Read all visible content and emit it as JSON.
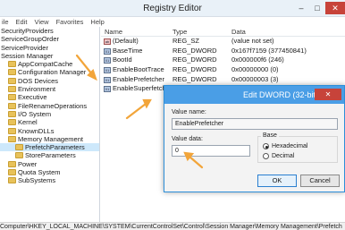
{
  "window": {
    "title": "Registry Editor",
    "controls": {
      "minimize": "–",
      "maximize": "□",
      "close": "✕"
    }
  },
  "menu": [
    "ile",
    "Edit",
    "View",
    "Favorites",
    "Help"
  ],
  "tree": [
    {
      "label": "SecurityProviders",
      "indent": 0
    },
    {
      "label": "ServiceGroupOrder",
      "indent": 0
    },
    {
      "label": "ServiceProvider",
      "indent": 0
    },
    {
      "label": "Session Manager",
      "indent": 0
    },
    {
      "label": "AppCompatCache",
      "indent": 1
    },
    {
      "label": "Configuration Manager",
      "indent": 1
    },
    {
      "label": "DOS Devices",
      "indent": 1
    },
    {
      "label": "Environment",
      "indent": 1
    },
    {
      "label": "Executive",
      "indent": 1
    },
    {
      "label": "FileRenameOperations",
      "indent": 1
    },
    {
      "label": "I/O System",
      "indent": 1
    },
    {
      "label": "Kernel",
      "indent": 1
    },
    {
      "label": "KnownDLLs",
      "indent": 1
    },
    {
      "label": "Memory Management",
      "indent": 1
    },
    {
      "label": "PrefetchParameters",
      "indent": 2
    },
    {
      "label": "StoreParameters",
      "indent": 2
    },
    {
      "label": "Power",
      "indent": 1
    },
    {
      "label": "Quota System",
      "indent": 1
    },
    {
      "label": "SubSystems",
      "indent": 1
    }
  ],
  "list": {
    "headers": {
      "name": "Name",
      "type": "Type",
      "data": "Data"
    },
    "rows": [
      {
        "name": "(Default)",
        "type": "REG_SZ",
        "data": "(value not set)",
        "icon": "string-value-icon"
      },
      {
        "name": "BaseTime",
        "type": "REG_DWORD",
        "data": "0x167f7159 (377450841)",
        "icon": "dword-value-icon"
      },
      {
        "name": "BootId",
        "type": "REG_DWORD",
        "data": "0x000000f6 (246)",
        "icon": "dword-value-icon"
      },
      {
        "name": "EnableBootTrace",
        "type": "REG_DWORD",
        "data": "0x00000000 (0)",
        "icon": "dword-value-icon"
      },
      {
        "name": "EnablePrefetcher",
        "type": "REG_DWORD",
        "data": "0x00000003 (3)",
        "icon": "dword-value-icon"
      },
      {
        "name": "EnableSuperfetch",
        "type": "REG_DWORD",
        "data": "",
        "icon": "dword-value-icon"
      }
    ]
  },
  "status": "Computer\\HKEY_LOCAL_MACHINE\\SYSTEM\\CurrentControlSet\\Control\\Session Manager\\Memory Management\\Prefetch",
  "dialog": {
    "title": "Edit DWORD (32-bit) Value",
    "close": "✕",
    "value_name_label": "Value name:",
    "value_name": "EnablePrefetcher",
    "value_data_label": "Value data:",
    "value_data": "0",
    "base_label": "Base",
    "hex_label": "Hexadecimal",
    "dec_label": "Decimal",
    "base_selected": "Hexadecimal",
    "ok_label": "OK",
    "cancel_label": "Cancel"
  },
  "colors": {
    "arrow": "#f2a53a",
    "dialog_title": "#4a9ee6",
    "close": "#c7433a"
  }
}
